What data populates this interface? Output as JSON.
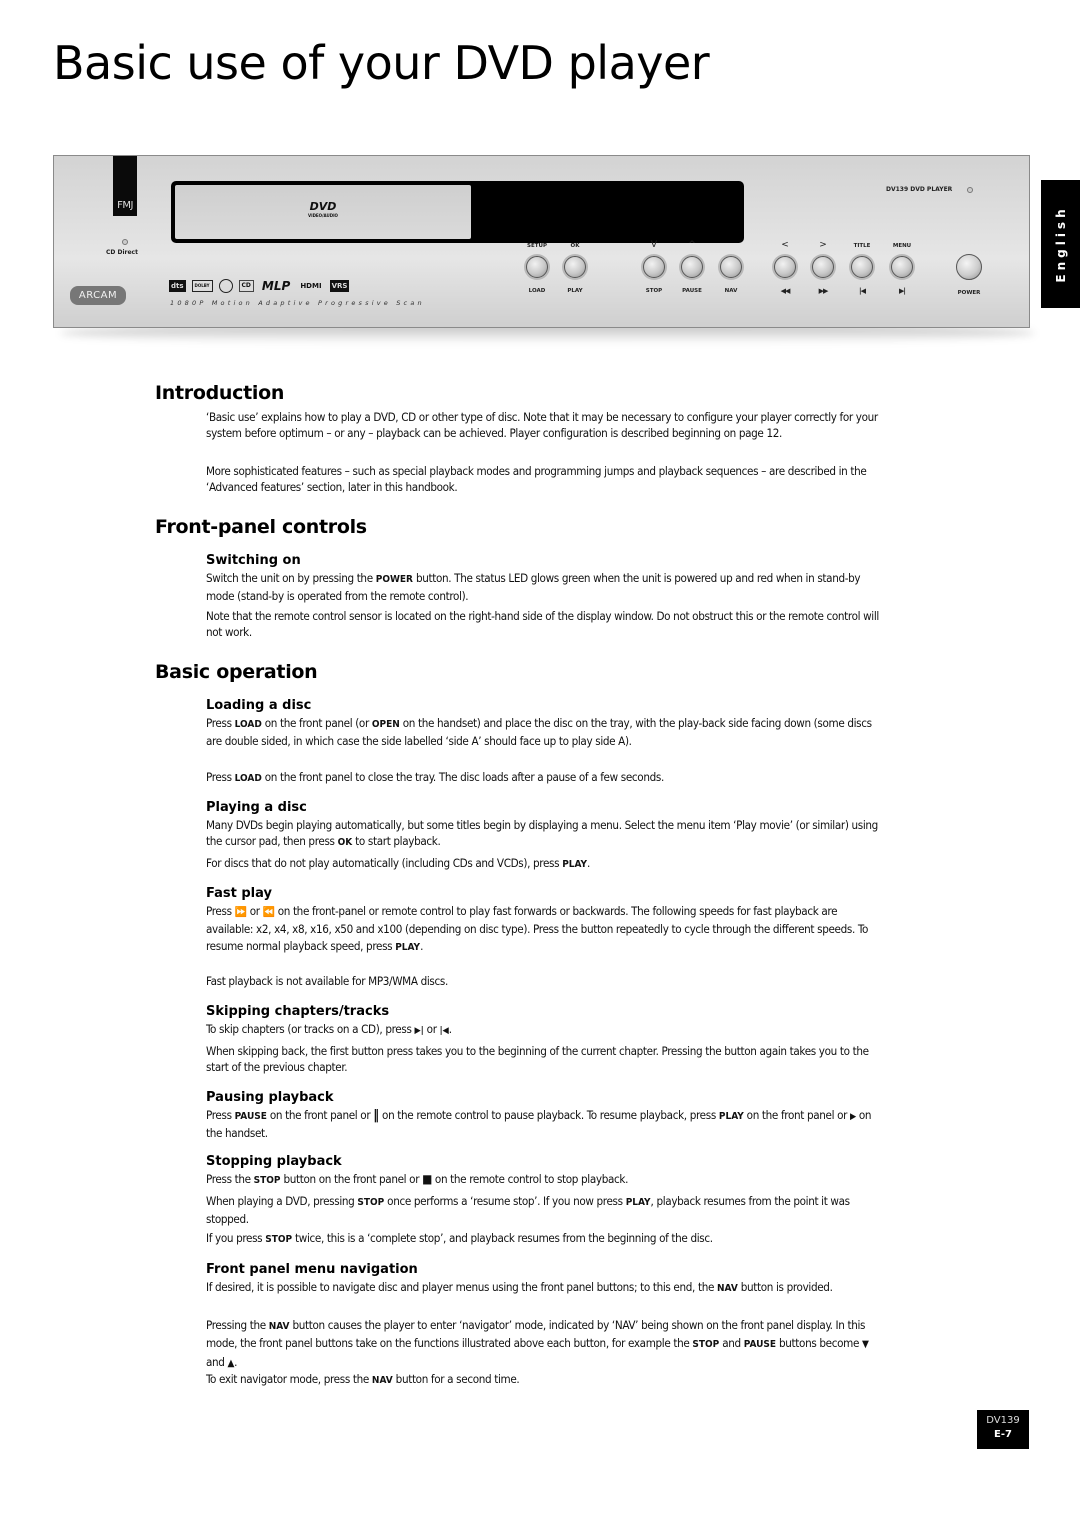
{
  "page": {
    "title": "Basic use of your DVD player",
    "language_tab": "English",
    "footer": {
      "model": "DV139",
      "page": "E-7"
    }
  },
  "front_panel": {
    "brand_badge": "FMJ",
    "cd_direct_label": "CD Direct",
    "brand_logo": "ARCAM",
    "dvd_logo": "DVD",
    "dvd_logo_sub": "VIDEO/AUDIO",
    "format_logos": [
      "dts",
      "DOLBY DIGITAL",
      "SACD",
      "CD",
      "MLP",
      "HDMI",
      "VRS"
    ],
    "scan_label": "1080P Motion Adaptive Progressive Scan",
    "model_label": "DV139 DVD PLAYER",
    "buttons": [
      {
        "top": "SETUP",
        "bottom": "LOAD"
      },
      {
        "top": "OK",
        "bottom": "PLAY"
      },
      {
        "top": "V",
        "bottom": "STOP"
      },
      {
        "top": "^",
        "bottom": "PAUSE"
      },
      {
        "top": "",
        "bottom": "NAV"
      },
      {
        "top": "<",
        "bottom": "◀◀"
      },
      {
        "top": ">",
        "bottom": "▶▶"
      },
      {
        "top": "TITLE",
        "bottom": "|◀"
      },
      {
        "top": "MENU",
        "bottom": "▶|"
      },
      {
        "top": "",
        "bottom": "POWER"
      }
    ]
  },
  "sections": {
    "introduction": {
      "heading": "Introduction",
      "p1": "‘Basic use’ explains how to play a DVD, CD or other type of disc. Note that it may be necessary to configure your player correctly for your system before optimum – or any – playback can be achieved. Player configuration is described beginning on page 12.",
      "p2": "More sophisticated features – such as special playback modes and programming jumps and playback sequences – are described in the ‘Advanced features’ section, later in this handbook."
    },
    "front_panel_controls": {
      "heading": "Front-panel controls",
      "switching_on": {
        "heading": "Switching on",
        "p1_a": "Switch the unit on by pressing the ",
        "p1_b": "POWER",
        "p1_c": " button. The status LED glows green when the unit is powered up and red when in stand-by mode (stand-by is operated from the remote control).",
        "p2": "Note that the remote control sensor is located on the right-hand side of the display window. Do not obstruct this or the remote control will not work."
      }
    },
    "basic_operation": {
      "heading": "Basic operation",
      "loading": {
        "heading": "Loading a disc",
        "p1_a": "Press ",
        "p1_b": "LOAD",
        "p1_c": " on the front panel (or ",
        "p1_d": "OPEN",
        "p1_e": " on the handset) and place the disc on the tray, with the play-back side facing down (some discs are double sided, in which case the side labelled ‘side A’ should face up to play side A).",
        "p2_a": "Press ",
        "p2_b": "LOAD",
        "p2_c": " on the front panel to close the tray. The disc loads after a pause of a few seconds."
      },
      "playing": {
        "heading": "Playing a disc",
        "p1_a": "Many DVDs begin playing automatically, but some titles begin by displaying a menu. Select the menu item ‘Play movie’ (or similar) using the cursor pad, then press ",
        "p1_b": "OK",
        "p1_c": " to start playback.",
        "p2_a": "For discs that do not play automatically (including CDs and VCDs), press ",
        "p2_b": "PLAY",
        "p2_c": "."
      },
      "fast_play": {
        "heading": "Fast play",
        "p1_a": "Press ",
        "icon_ff": "⏩",
        "p1_b": " or ",
        "icon_rw": "⏪",
        "p1_c": " on the front-panel or remote control to play fast forwards or backwards. The following speeds for fast playback are available: x2, x4, x8, x16, x50 and x100 (depending on disc type). Press the button repeatedly to cycle through the different speeds. To resume normal playback speed, press ",
        "p1_d": "PLAY",
        "p1_e": ".",
        "p2": "Fast playback is not available for MP3/WMA discs."
      },
      "skipping": {
        "heading": "Skipping chapters/tracks",
        "p1_a": "To skip chapters (or tracks on a CD), press ",
        "icon_next": "▶|",
        "p1_b": " or ",
        "icon_prev": "|◀",
        "p1_c": ".",
        "p2": "When skipping back, the first button press takes you to the beginning of the current chapter. Pressing the button again takes you to the start of the previous chapter."
      },
      "pausing": {
        "heading": "Pausing playback",
        "p1_a": "Press ",
        "p1_b": "PAUSE",
        "p1_c": " on the front panel or ",
        "icon_pause": "‖",
        "p1_d": " on the remote control to pause playback. To resume playback, press ",
        "p1_e": "PLAY",
        "p1_f": " on the front panel or ",
        "icon_play": "▶",
        "p1_g": " on the handset."
      },
      "stopping": {
        "heading": "Stopping playback",
        "p1_a": "Press the ",
        "p1_b": "STOP",
        "p1_c": " button on the front panel or ",
        "icon_stop": "■",
        "p1_d": " on the remote control to stop playback.",
        "p2_a": "When playing a DVD, pressing ",
        "p2_b": "STOP",
        "p2_c": " once performs a ‘resume stop’. If you now press ",
        "p2_d": "PLAY",
        "p2_e": ", playback resumes from the point it was stopped.",
        "p3_a": "If you press ",
        "p3_b": "STOP",
        "p3_c": " twice, this is a ‘complete stop’, and playback resumes from the beginning of the disc."
      },
      "nav": {
        "heading": "Front panel menu navigation",
        "p1_a": "If desired, it is possible to navigate disc and player menus using the front panel buttons; to this end, the ",
        "p1_b": "NAV",
        "p1_c": " button is provided.",
        "p2_a": "Pressing the ",
        "p2_b": "NAV",
        "p2_c": " button causes the player to enter ‘navigator’ mode, indicated by ‘NAV’ being shown on the front panel display. In this mode, the front panel buttons take on the functions illustrated above each button, for example the ",
        "p2_d": "STOP",
        "p2_e": " and ",
        "p2_f": "PAUSE",
        "p2_g": " buttons become ",
        "icon_down": "▼",
        "p2_h": " and ",
        "icon_up": "▲",
        "p2_i": ".",
        "p3_a": "To exit navigator mode, press the ",
        "p3_b": "NAV",
        "p3_c": " button for a second time."
      }
    }
  }
}
